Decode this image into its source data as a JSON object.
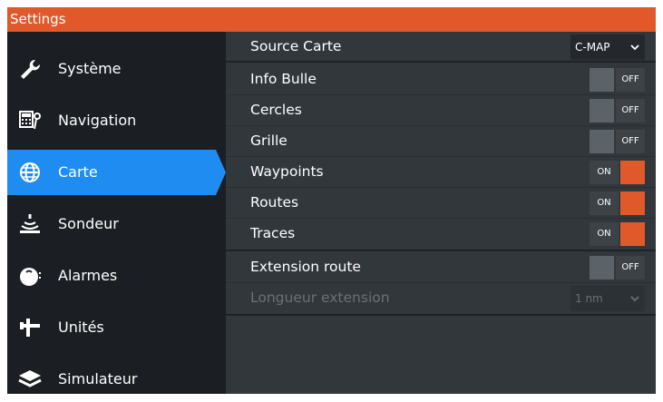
{
  "window": {
    "title": "Settings"
  },
  "colors": {
    "accent": "#e1592b",
    "active": "#1e8cf0",
    "sidebar_bg": "#1b1e22",
    "content_bg": "#32373c"
  },
  "sidebar": {
    "items": [
      {
        "label": "Système",
        "icon": "wrench-icon",
        "active": false
      },
      {
        "label": "Navigation",
        "icon": "navigation-icon",
        "active": false
      },
      {
        "label": "Carte",
        "icon": "globe-icon",
        "active": true
      },
      {
        "label": "Sondeur",
        "icon": "sonar-icon",
        "active": false
      },
      {
        "label": "Alarmes",
        "icon": "alarm-icon",
        "active": false
      },
      {
        "label": "Unités",
        "icon": "units-icon",
        "active": false
      },
      {
        "label": "Simulateur",
        "icon": "layers-icon",
        "active": false
      }
    ]
  },
  "settings": {
    "chart_source": {
      "label": "Source Carte",
      "value": "C-MAP"
    },
    "info_bulle": {
      "label": "Info Bulle",
      "state": "OFF"
    },
    "cercles": {
      "label": "Cercles",
      "state": "OFF"
    },
    "grille": {
      "label": "Grille",
      "state": "OFF"
    },
    "waypoints": {
      "label": "Waypoints",
      "state": "ON"
    },
    "routes": {
      "label": "Routes",
      "state": "ON"
    },
    "traces": {
      "label": "Traces",
      "state": "ON"
    },
    "extension_route": {
      "label": "Extension route",
      "state": "OFF"
    },
    "longueur_extension": {
      "label": "Longueur extension",
      "value": "1 nm"
    }
  }
}
